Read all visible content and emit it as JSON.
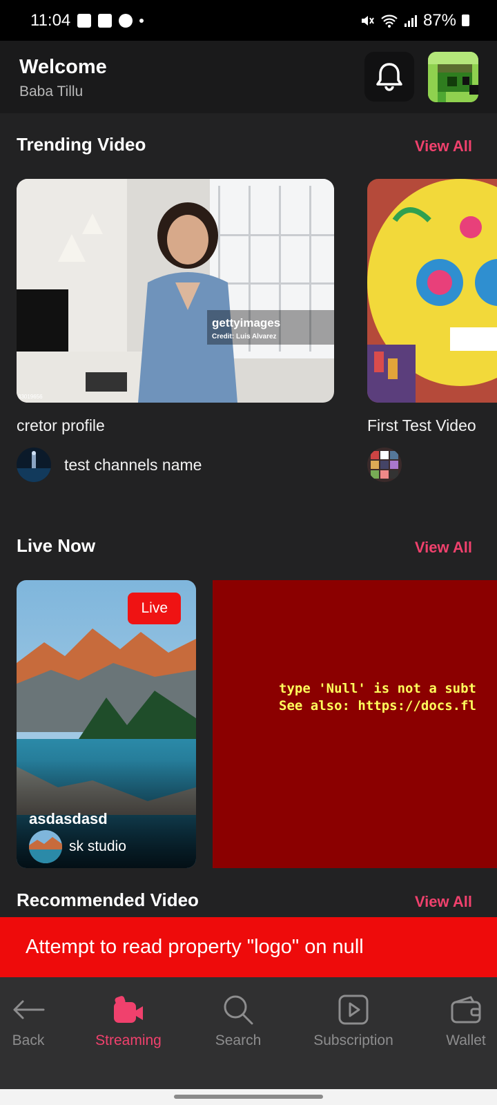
{
  "status_bar": {
    "time": "11:04",
    "battery": "87%"
  },
  "header": {
    "welcome": "Welcome",
    "username": "Baba Tillu"
  },
  "trending": {
    "title": "Trending Video",
    "view_all": "View All",
    "videos": [
      {
        "title": "cretor profile",
        "channel": "test channels name",
        "watermark_brand": "gettyimages",
        "watermark_credit": "Credit: Luis Alvarez",
        "image_id": "33019656"
      },
      {
        "title": "First Test Video",
        "channel": ""
      }
    ]
  },
  "live": {
    "title": "Live Now",
    "view_all": "View All",
    "streams": [
      {
        "badge": "Live",
        "title": "asdasdasd",
        "channel": "sk studio"
      }
    ],
    "error_line1": "type 'Null' is not a subt",
    "error_line2": "See also: https://docs.fl"
  },
  "recommended": {
    "title": "Recommended Video",
    "view_all": "View All"
  },
  "toast": {
    "message": "Attempt to read property \"logo\" on null"
  },
  "bottom_nav": {
    "items": [
      {
        "label": "Back",
        "icon": "back-arrow-icon"
      },
      {
        "label": "Streaming",
        "icon": "video-camera-icon",
        "active": true
      },
      {
        "label": "Search",
        "icon": "search-icon"
      },
      {
        "label": "Subscription",
        "icon": "play-square-icon"
      },
      {
        "label": "Wallet",
        "icon": "wallet-icon"
      }
    ]
  },
  "colors": {
    "accent": "#f0416d",
    "live_badge": "#ef1313",
    "toast": "#ee0b0b",
    "error_panel": "#8b0000"
  }
}
